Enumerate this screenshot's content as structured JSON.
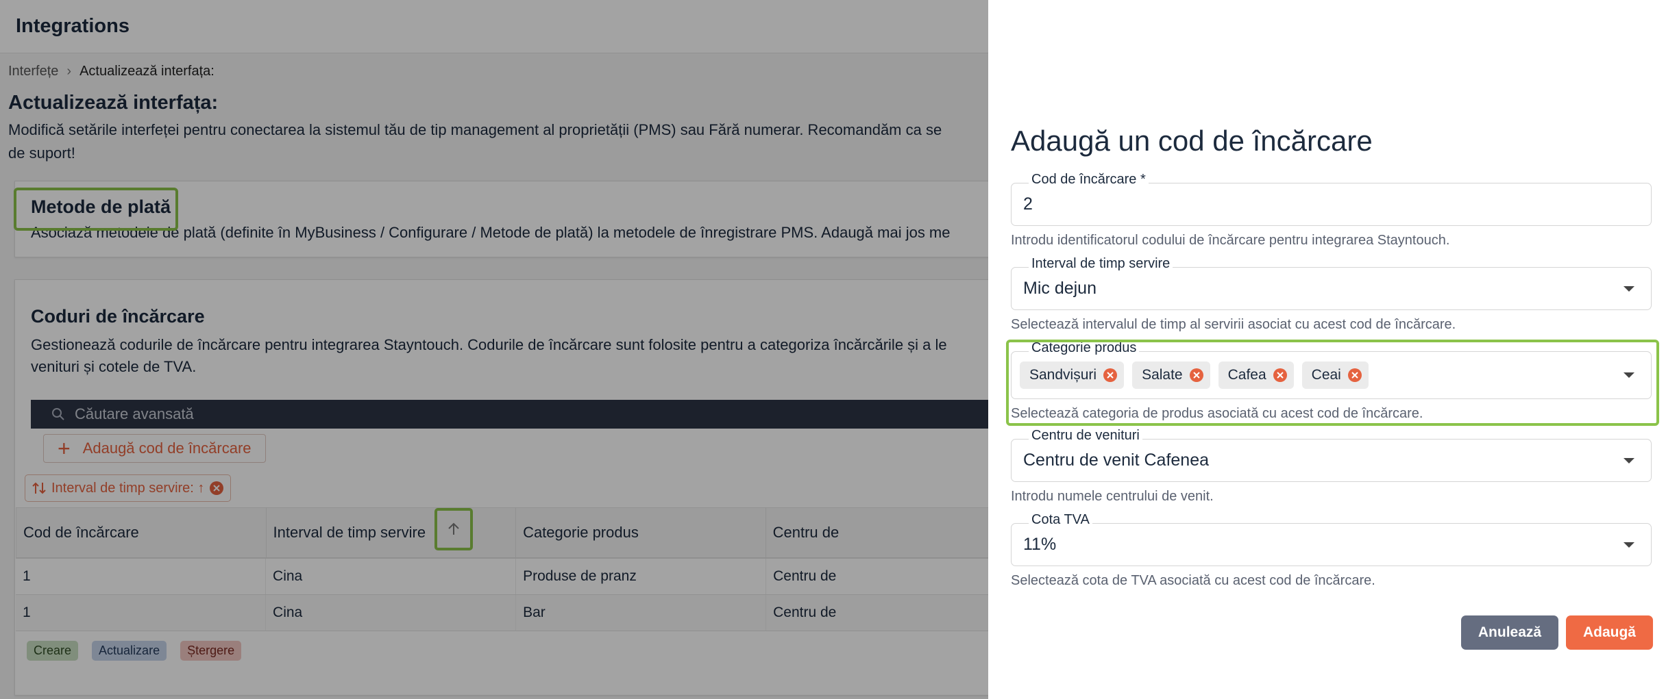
{
  "app": {
    "title": "Integrations"
  },
  "breadcrumb": {
    "root": "Interfețe",
    "separator": "›",
    "current": "Actualizează interfața:"
  },
  "page": {
    "heading": "Actualizează interfața:",
    "description": "Modifică setările interfeței pentru conectarea la sistemul tău de tip management al proprietății (PMS) sau Fără numerar. Recomandăm ca se",
    "description_cont": "de suport!"
  },
  "payment_methods": {
    "heading": "Metode de plată",
    "description": "Asociază metodele de plată (definite în MyBusiness / Configurare / Metode de plată) la metodele de înregistrare PMS. Adaugă mai jos me"
  },
  "charge_codes": {
    "heading": "Coduri de încărcare",
    "description": "Gestionează codurile de încărcare pentru integrarea Stayntouch. Codurile de încărcare sunt folosite pentru a categoriza încărcările și a le",
    "description_cont": "venituri și cotele de TVA.",
    "search_placeholder": "Căutare avansată",
    "add_button": "Adaugă cod de încărcare",
    "sort_chip": "Interval de timp servire: ↑",
    "columns": [
      "Cod de încărcare",
      "Interval de timp servire",
      "Categorie produs",
      "Centru de"
    ],
    "rows": [
      [
        "1",
        "Cina",
        "Produse de pranz",
        "Centru de"
      ],
      [
        "1",
        "Cina",
        "Bar",
        "Centru de"
      ]
    ],
    "legend": {
      "create": "Creare",
      "update": "Actualizare",
      "delete": "Ștergere"
    }
  },
  "drawer": {
    "title": "Adaugă un cod de încărcare",
    "charge_code": {
      "label": "Cod de încărcare *",
      "value": "2",
      "helper": "Introdu identificatorul codului de încărcare pentru integrarea Stayntouch."
    },
    "service_interval": {
      "label": "Interval de timp servire",
      "value": "Mic dejun",
      "helper": "Selectează intervalul de timp al servirii asociat cu acest cod de încărcare."
    },
    "product_category": {
      "label": "Categorie produs",
      "chips": [
        "Sandvișuri",
        "Salate",
        "Cafea",
        "Ceai"
      ],
      "helper": "Selectează categoria de produs asociată cu acest cod de încărcare."
    },
    "revenue_center": {
      "label": "Centru de venituri",
      "value": "Centru de venit Cafenea",
      "helper": "Introdu numele centrului de venit."
    },
    "vat_rate": {
      "label": "Cota TVA",
      "value": "11%",
      "helper": "Selectează cota de TVA asociată cu acest cod de încărcare."
    },
    "cancel_button": "Anulează",
    "add_button": "Adaugă"
  },
  "colors": {
    "accent": "#ef6a44",
    "highlight": "#8bc34a",
    "cancel": "#656d80",
    "dark_bar": "#2d3446"
  }
}
